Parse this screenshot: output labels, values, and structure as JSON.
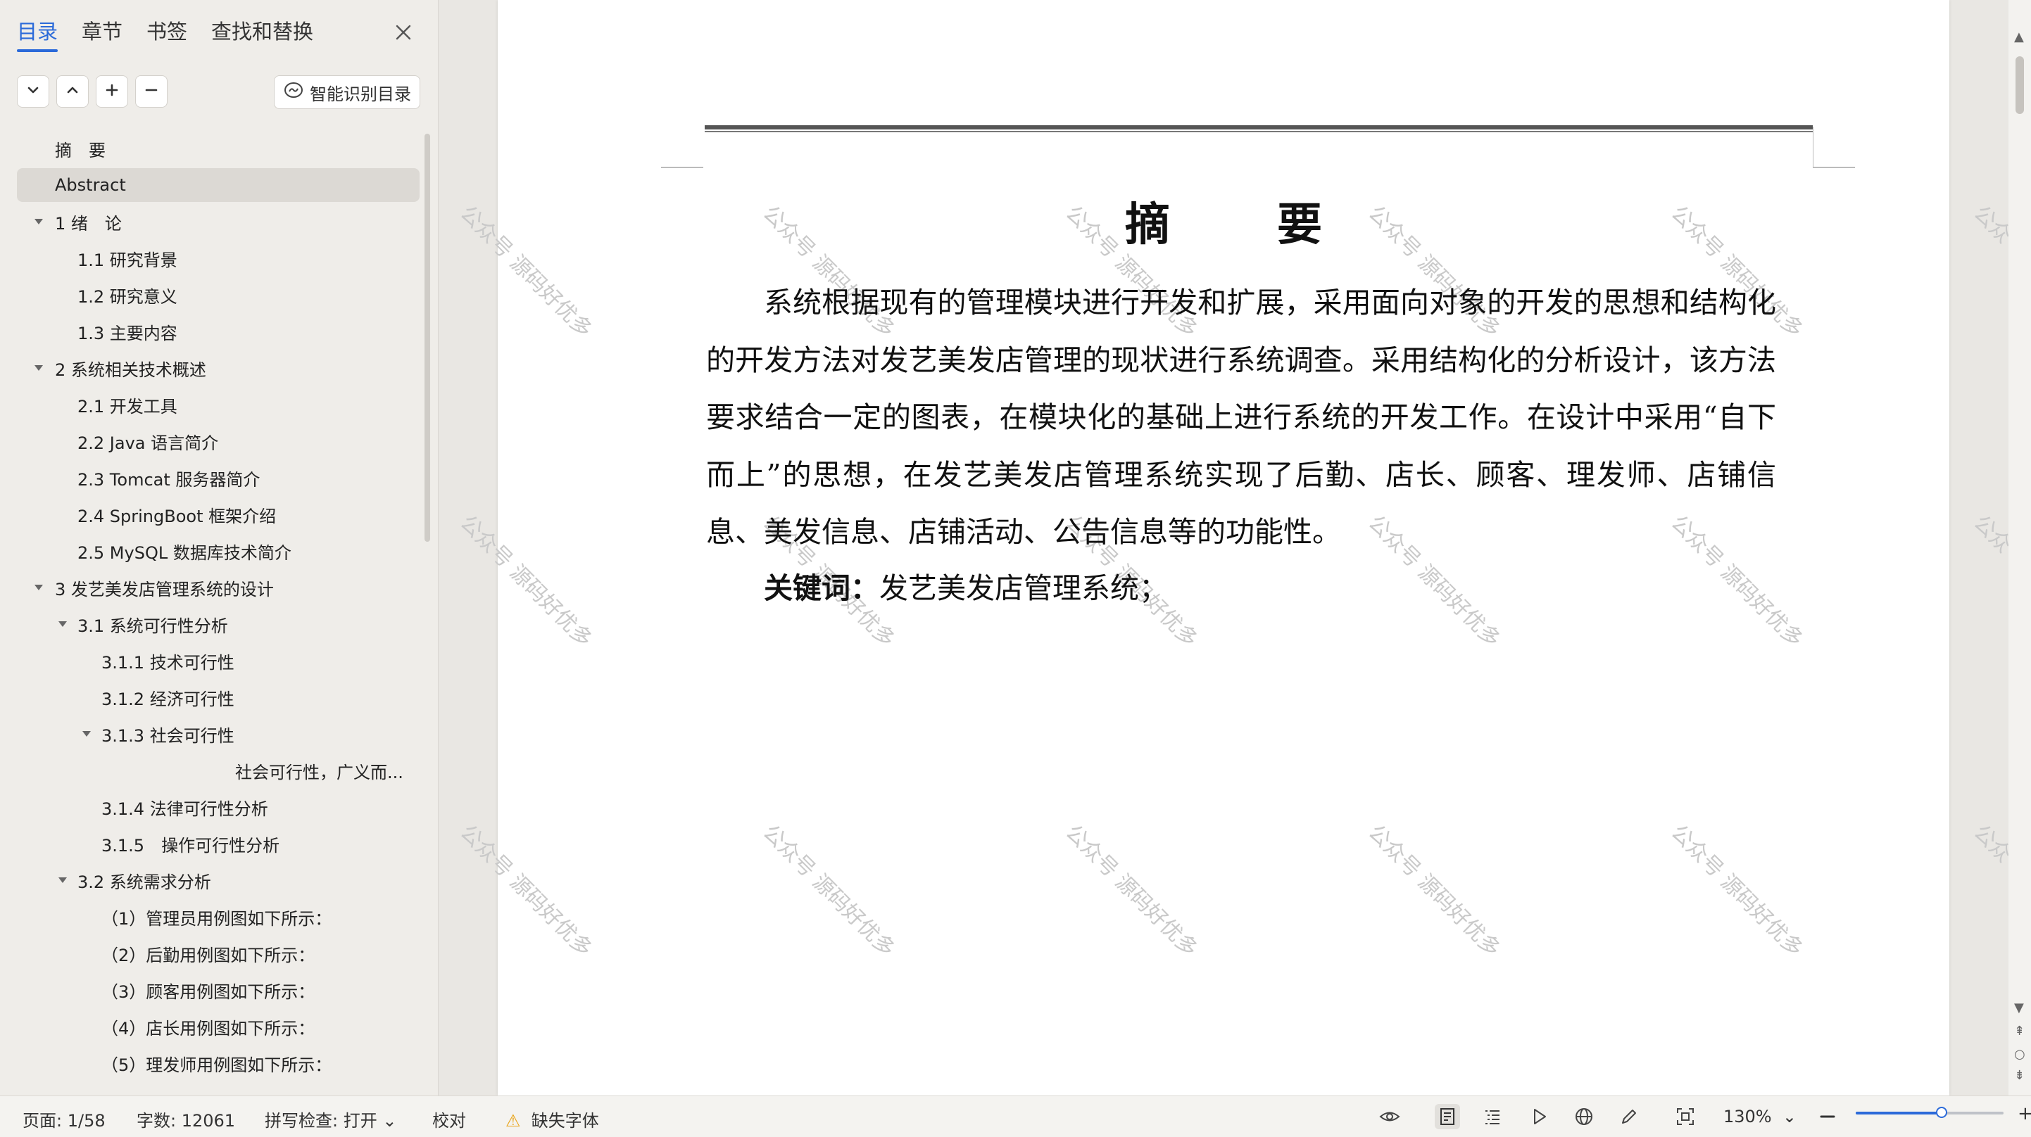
{
  "nav": {
    "tabs": [
      {
        "label": "目录",
        "active": true
      },
      {
        "label": "章节",
        "active": false
      },
      {
        "label": "书签",
        "active": false
      },
      {
        "label": "查找和替换",
        "active": false
      }
    ],
    "toolbar_icons": [
      "chevron-down-icon",
      "chevron-up-icon",
      "plus-icon",
      "minus-icon"
    ],
    "ai_button_label": "智能识别目录",
    "toc": [
      {
        "label": "摘　要",
        "level": 0,
        "caret": "none",
        "selected": false
      },
      {
        "label": "Abstract",
        "level": 0,
        "caret": "none",
        "selected": true
      },
      {
        "label": "1  绪　论",
        "level": 0,
        "caret": "expanded",
        "selected": false
      },
      {
        "label": "1.1  研究背景",
        "level": 1,
        "caret": "none",
        "selected": false
      },
      {
        "label": "1.2  研究意义",
        "level": 1,
        "caret": "none",
        "selected": false
      },
      {
        "label": "1.3  主要内容",
        "level": 1,
        "caret": "none",
        "selected": false
      },
      {
        "label": "2 系统相关技术概述",
        "level": 0,
        "caret": "expanded",
        "selected": false
      },
      {
        "label": "2.1 开发工具",
        "level": 1,
        "caret": "none",
        "selected": false
      },
      {
        "label": "2.2 Java 语言简介",
        "level": 1,
        "caret": "none",
        "selected": false
      },
      {
        "label": "2.3 Tomcat 服务器简介",
        "level": 1,
        "caret": "none",
        "selected": false
      },
      {
        "label": "2.4 SpringBoot 框架介绍",
        "level": 1,
        "caret": "none",
        "selected": false
      },
      {
        "label": "2.5 MySQL 数据库技术简介",
        "level": 1,
        "caret": "none",
        "selected": false
      },
      {
        "label": "3  发艺美发店管理系统的设计",
        "level": 0,
        "caret": "expanded",
        "selected": false
      },
      {
        "label": "3.1 系统可行性分析",
        "level": 1,
        "caret": "expanded",
        "selected": false
      },
      {
        "label": "3.1.1 技术可行性",
        "level": 2,
        "caret": "none",
        "selected": false
      },
      {
        "label": "3.1.2 经济可行性",
        "level": 2,
        "caret": "none",
        "selected": false
      },
      {
        "label": "3.1.3 社会可行性",
        "level": 2,
        "caret": "expanded",
        "selected": false
      },
      {
        "label": "社会可行性，广义而...",
        "level": 3,
        "caret": "none",
        "selected": false
      },
      {
        "label": "3.1.4 法律可行性分析",
        "level": 2,
        "caret": "none",
        "selected": false
      },
      {
        "label": "3.1.5　操作可行性分析",
        "level": 2,
        "caret": "none",
        "selected": false
      },
      {
        "label": "3.2  系统需求分析",
        "level": 1,
        "caret": "expanded",
        "selected": false
      },
      {
        "label": "（1）管理员用例图如下所示：",
        "level": 2,
        "caret": "none",
        "selected": false
      },
      {
        "label": "（2）后勤用例图如下所示：",
        "level": 2,
        "caret": "none",
        "selected": false
      },
      {
        "label": "（3）顾客用例图如下所示：",
        "level": 2,
        "caret": "none",
        "selected": false
      },
      {
        "label": "（4）店长用例图如下所示：",
        "level": 2,
        "caret": "none",
        "selected": false
      },
      {
        "label": "（5）理发师用例图如下所示：",
        "level": 2,
        "caret": "none",
        "selected": false
      }
    ]
  },
  "document": {
    "title": "摘　要",
    "body": "系统根据现有的管理模块进行开发和扩展，采用面向对象的开发的思想和结构化的开发方法对发艺美发店管理的现状进行系统调查。采用结构化的分析设计，该方法要求结合一定的图表，在模块化的基础上进行系统的开发工作。在设计中采用“自下而上”的思想，在发艺美发店管理系统实现了后勤、店长、顾客、理发师、店铺信息、美发信息、店铺活动、公告信息等的功能性。",
    "keywords_label": "关键词：",
    "keywords_value": "发艺美发店管理系统；",
    "watermark": "公众号 源码好优多"
  },
  "status": {
    "page": "页面: 1/58",
    "words": "字数: 12061",
    "spellcheck": "拼写检查: 打开",
    "proofread": "校对",
    "missing_fonts": "缺失字体",
    "zoom": "130%",
    "zoom_level_fraction": 0.58
  },
  "colors": {
    "accent": "#2b6ad9",
    "warning": "#e8a317"
  }
}
